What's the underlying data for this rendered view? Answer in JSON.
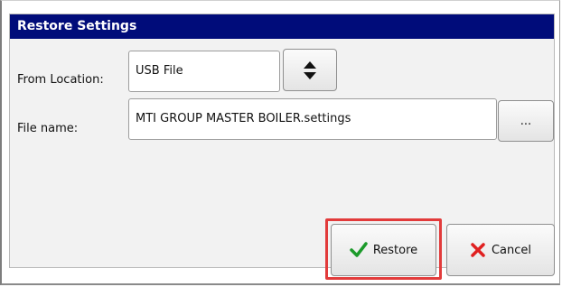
{
  "dialog": {
    "title": "Restore Settings"
  },
  "form": {
    "from_location_label": "From Location:",
    "from_location_value": "USB File",
    "file_name_label": "File name:",
    "file_name_value": "MTI GROUP MASTER BOILER.settings",
    "browse_label": "..."
  },
  "buttons": {
    "restore_label": "Restore",
    "cancel_label": "Cancel"
  },
  "icons": {
    "updown": "up-down-arrows-icon",
    "check": "checkmark-icon",
    "cancel": "x-mark-icon"
  },
  "colors": {
    "title_bg": "#000c7a",
    "check": "#1b9a2a",
    "cancel_x": "#e02020",
    "highlight": "#e23b3b"
  }
}
